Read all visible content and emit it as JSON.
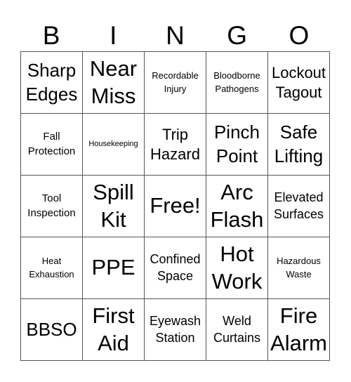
{
  "header": [
    "B",
    "I",
    "N",
    "G",
    "O"
  ],
  "cells": [
    {
      "text": "Sharp Edges",
      "size": "s-l"
    },
    {
      "text": "Near Miss",
      "size": "s-xl"
    },
    {
      "text": "Recordable Injury",
      "size": "s-xs"
    },
    {
      "text": "Bloodborne Pathogens",
      "size": "s-xs"
    },
    {
      "text": "Lockout Tagout",
      "size": "s-l2"
    },
    {
      "text": "Fall Protection",
      "size": "s-s"
    },
    {
      "text": "Housekeeping",
      "size": "s-xxs"
    },
    {
      "text": "Trip Hazard",
      "size": "s-l2"
    },
    {
      "text": "Pinch Point",
      "size": "s-l"
    },
    {
      "text": "Safe Lifting",
      "size": "s-l"
    },
    {
      "text": "Tool Inspection",
      "size": "s-s"
    },
    {
      "text": "Spill Kit",
      "size": "s-xl"
    },
    {
      "text": "Free!",
      "size": "s-xl"
    },
    {
      "text": "Arc Flash",
      "size": "s-xl"
    },
    {
      "text": "Elevated Surfaces",
      "size": "s-m"
    },
    {
      "text": "Heat Exhaustion",
      "size": "s-xs"
    },
    {
      "text": "PPE",
      "size": "s-xl"
    },
    {
      "text": "Confined Space",
      "size": "s-m"
    },
    {
      "text": "Hot Work",
      "size": "s-xl"
    },
    {
      "text": "Hazardous Waste",
      "size": "s-xs"
    },
    {
      "text": "BBSO",
      "size": "s-l"
    },
    {
      "text": "First Aid",
      "size": "s-xl"
    },
    {
      "text": "Eyewash Station",
      "size": "s-m"
    },
    {
      "text": "Weld Curtains",
      "size": "s-m"
    },
    {
      "text": "Fire Alarm",
      "size": "s-xl"
    }
  ]
}
